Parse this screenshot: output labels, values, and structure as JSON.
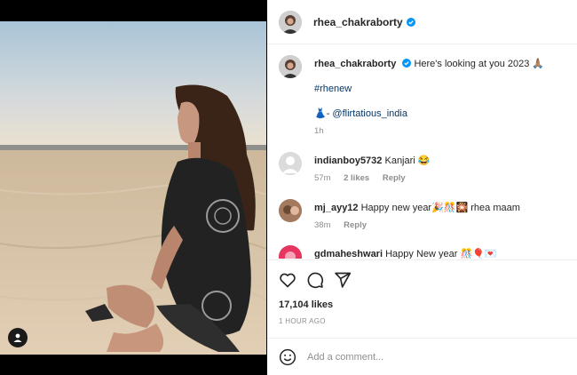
{
  "post": {
    "username": "rhea_chakraborty",
    "caption_text": "Here's looking at you 2023 🙏🏽",
    "hashtag": "#rhenew",
    "credit_prefix": "👗-",
    "credit_mention": "@flirtatious_india",
    "caption_age": "1h",
    "likes_text": "17,104 likes",
    "time_ago": "1 HOUR AGO"
  },
  "comments": [
    {
      "user": "indianboy5732",
      "text": "Kanjari 😂",
      "age": "57m",
      "likes": "2 likes",
      "reply": "Reply"
    },
    {
      "user": "mj_ayy12",
      "text": "Happy new year🎉🎊🎇 rhea maam",
      "age": "38m",
      "likes": "",
      "reply": "Reply"
    },
    {
      "user": "gdmaheshwari",
      "text": "Happy New year 🎊🎈💌",
      "age": "",
      "likes": "",
      "reply": ""
    }
  ],
  "add_comment": {
    "placeholder": "Add a comment..."
  },
  "icons": {
    "like": "heart-icon",
    "comment": "comment-icon",
    "share": "send-icon",
    "emoji": "smiley-icon",
    "verified": "verified-badge-icon",
    "tagged": "user-tag-icon"
  },
  "colors": {
    "verified": "#0095f6",
    "link": "#00376b",
    "muted": "#8e8e8e"
  }
}
